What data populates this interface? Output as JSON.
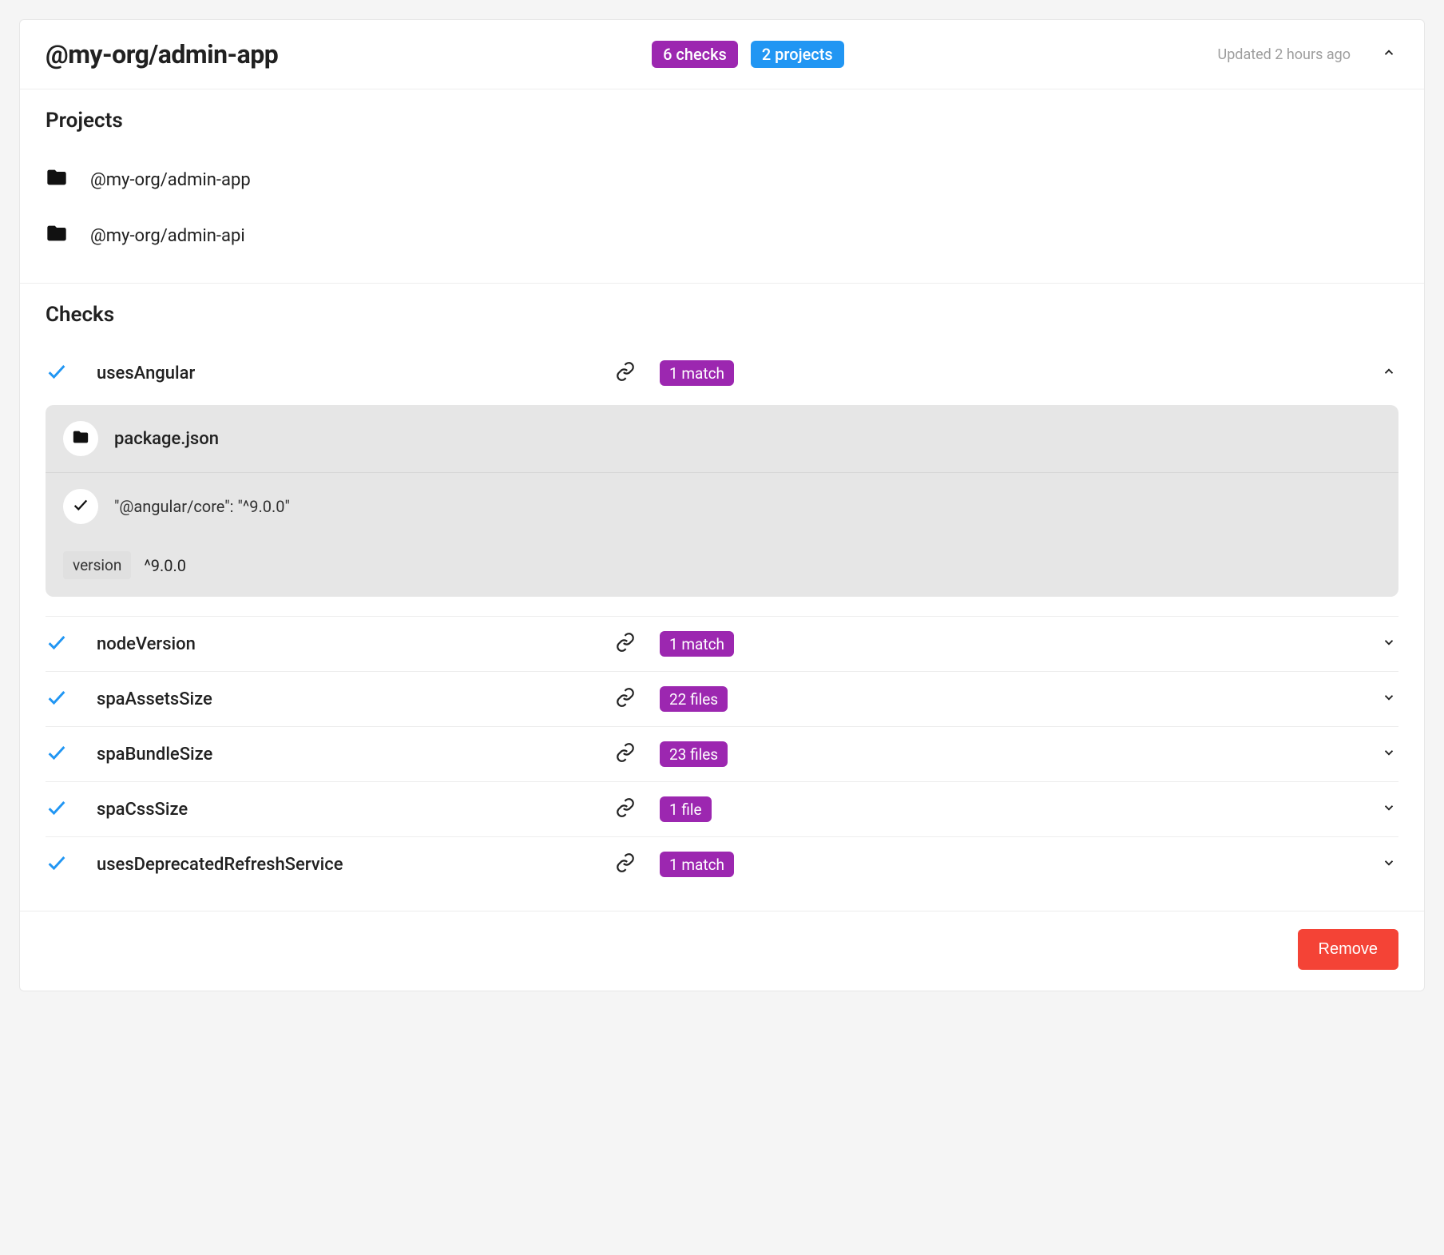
{
  "header": {
    "title": "@my-org/admin-app",
    "checks_badge": "6 checks",
    "projects_badge": "2 projects",
    "updated": "Updated 2 hours ago"
  },
  "projects": {
    "heading": "Projects",
    "items": [
      {
        "name": "@my-org/admin-app"
      },
      {
        "name": "@my-org/admin-api"
      }
    ]
  },
  "checks": {
    "heading": "Checks",
    "items": [
      {
        "name": "usesAngular",
        "count_label": "1 match",
        "expanded": true,
        "detail": {
          "file": "package.json",
          "match_line": "\"@angular/core\": \"^9.0.0\"",
          "kv": {
            "key": "version",
            "value": "^9.0.0"
          }
        }
      },
      {
        "name": "nodeVersion",
        "count_label": "1 match",
        "expanded": false
      },
      {
        "name": "spaAssetsSize",
        "count_label": "22 files",
        "expanded": false
      },
      {
        "name": "spaBundleSize",
        "count_label": "23 files",
        "expanded": false
      },
      {
        "name": "spaCssSize",
        "count_label": "1 file",
        "expanded": false
      },
      {
        "name": "usesDeprecatedRefreshService",
        "count_label": "1 match",
        "expanded": false
      }
    ]
  },
  "footer": {
    "remove_label": "Remove"
  },
  "colors": {
    "purple": "#9c27b0",
    "blue": "#2196f3",
    "danger": "#f44336"
  }
}
